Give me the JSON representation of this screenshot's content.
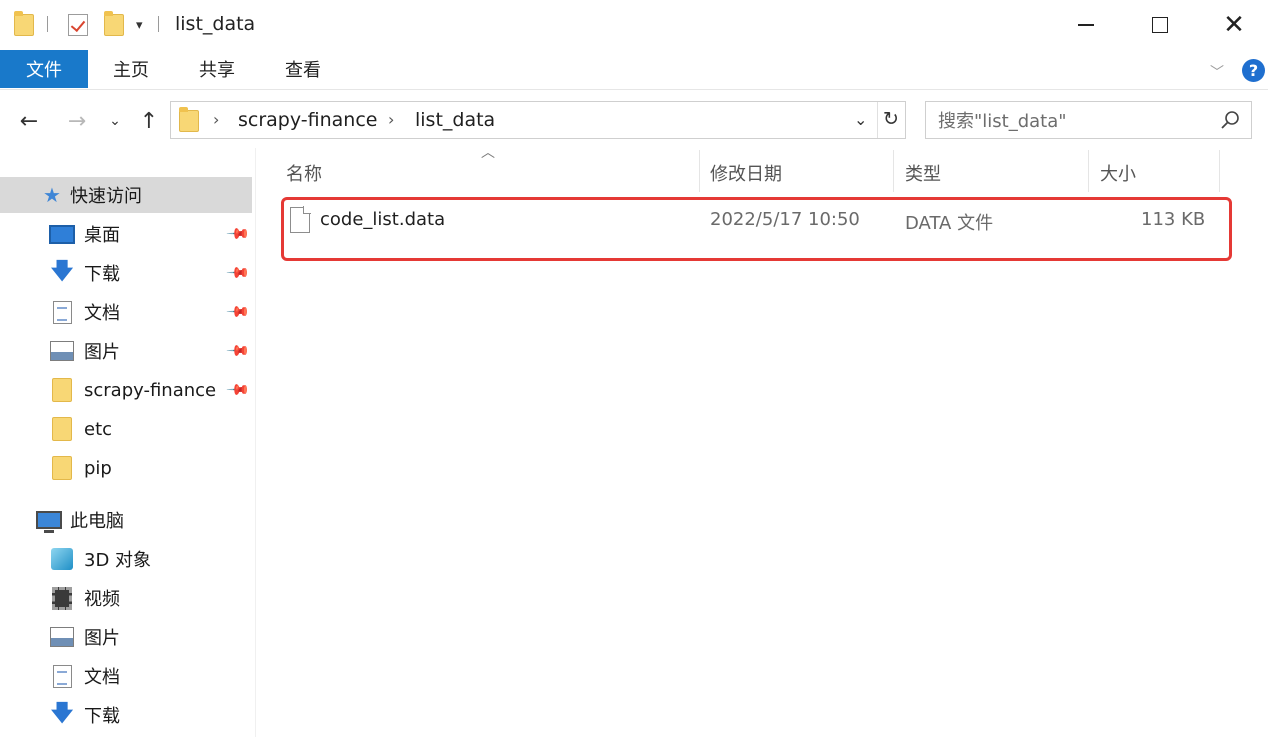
{
  "window": {
    "title": "list_data",
    "controls": {
      "minimize": "minimize",
      "maximize": "maximize",
      "close": "close"
    }
  },
  "ribbon": {
    "tabs": [
      {
        "label": "文件",
        "active": true
      },
      {
        "label": "主页"
      },
      {
        "label": "共享"
      },
      {
        "label": "查看"
      }
    ],
    "help": "?"
  },
  "address": {
    "crumbs": [
      "scrapy-finance",
      "list_data"
    ]
  },
  "search": {
    "placeholder": "搜索\"list_data\""
  },
  "nav": {
    "quick_access": "快速访问",
    "quick_items": [
      {
        "label": "桌面",
        "icon": "desktop-icon",
        "pinned": true
      },
      {
        "label": "下载",
        "icon": "download-icon",
        "pinned": true
      },
      {
        "label": "文档",
        "icon": "document-icon",
        "pinned": true
      },
      {
        "label": "图片",
        "icon": "picture-icon",
        "pinned": true
      },
      {
        "label": "scrapy-finance",
        "icon": "folder-icon",
        "pinned": true
      },
      {
        "label": "etc",
        "icon": "folder-icon",
        "pinned": false
      },
      {
        "label": "pip",
        "icon": "folder-icon",
        "pinned": false
      }
    ],
    "this_pc": "此电脑",
    "pc_items": [
      {
        "label": "3D 对象",
        "icon": "cube-icon"
      },
      {
        "label": "视频",
        "icon": "video-icon"
      },
      {
        "label": "图片",
        "icon": "picture-icon"
      },
      {
        "label": "文档",
        "icon": "document-icon"
      },
      {
        "label": "下载",
        "icon": "download-icon"
      }
    ]
  },
  "columns": {
    "name": "名称",
    "modified": "修改日期",
    "type": "类型",
    "size": "大小",
    "sort": "name ascending"
  },
  "files": [
    {
      "name": "code_list.data",
      "modified": "2022/5/17 10:50",
      "type": "DATA 文件",
      "size": "113 KB",
      "highlighted": true
    }
  ],
  "colors": {
    "accent": "#1979ca",
    "highlight": "#e53935",
    "folder": "#f8d775",
    "selected_nav": "#d9d9d9"
  }
}
